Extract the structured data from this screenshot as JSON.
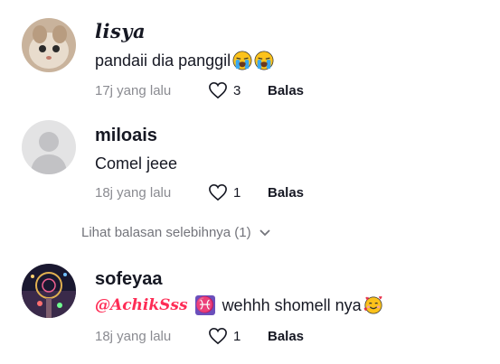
{
  "comments": [
    {
      "username": "lisya",
      "text": "pandaii dia panggil",
      "emojis": [
        "loudly-crying-face",
        "loudly-crying-face"
      ],
      "time": "17j yang lalu",
      "likes": "3",
      "reply_label": "Balas"
    },
    {
      "username": "miloais",
      "text": "Comel jeee",
      "time": "18j yang lalu",
      "likes": "1",
      "reply_label": "Balas"
    },
    {
      "username": "sofeyaa",
      "mention": "@AchikSss",
      "zodiac": "♓",
      "text": "wehhh shomell nya",
      "emojis": [
        "smiling-face-with-hearts"
      ],
      "time": "18j yang lalu",
      "likes": "1",
      "reply_label": "Balas"
    }
  ],
  "view_replies_label": "Lihat balasan selebihnya (1)",
  "colors": {
    "text": "#161823",
    "muted": "#8a8b91",
    "mention": "#fe2c55"
  }
}
